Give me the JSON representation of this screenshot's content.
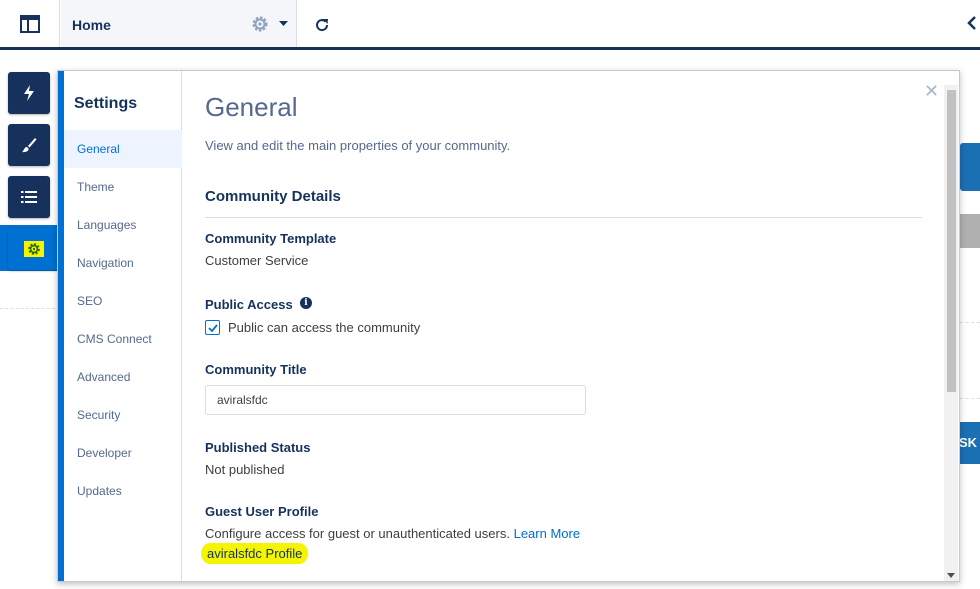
{
  "topbar": {
    "page_name": "Home",
    "app_icon": "layout-icon",
    "gear_icon": "gear-icon",
    "caret_icon": "caret-down-icon",
    "refresh_icon": "refresh-icon"
  },
  "background": {
    "button_text": "SK A"
  },
  "rail": {
    "items": [
      {
        "name": "lightning-icon"
      },
      {
        "name": "brush-icon"
      },
      {
        "name": "list-icon"
      },
      {
        "name": "settings-gear-icon"
      }
    ]
  },
  "settings": {
    "title": "Settings",
    "nav": [
      "General",
      "Theme",
      "Languages",
      "Navigation",
      "SEO",
      "CMS Connect",
      "Advanced",
      "Security",
      "Developer",
      "Updates"
    ],
    "active": "General"
  },
  "general": {
    "heading": "General",
    "description": "View and edit the main properties of your community.",
    "section_title": "Community Details",
    "template_label": "Community Template",
    "template_value": "Customer Service",
    "public_access_label": "Public Access",
    "public_access_checkbox": "Public can access the community",
    "public_access_checked": true,
    "title_label": "Community Title",
    "title_value": "aviralsfdc",
    "status_label": "Published Status",
    "status_value": "Not published",
    "guest_label": "Guest User Profile",
    "guest_desc": "Configure access for guest or unauthenticated users.",
    "learn_more": "Learn More",
    "profile_link": "aviralsfdc Profile"
  },
  "colors": {
    "navy": "#16325c",
    "brand_blue": "#0070d2",
    "highlight": "#f5f500"
  }
}
